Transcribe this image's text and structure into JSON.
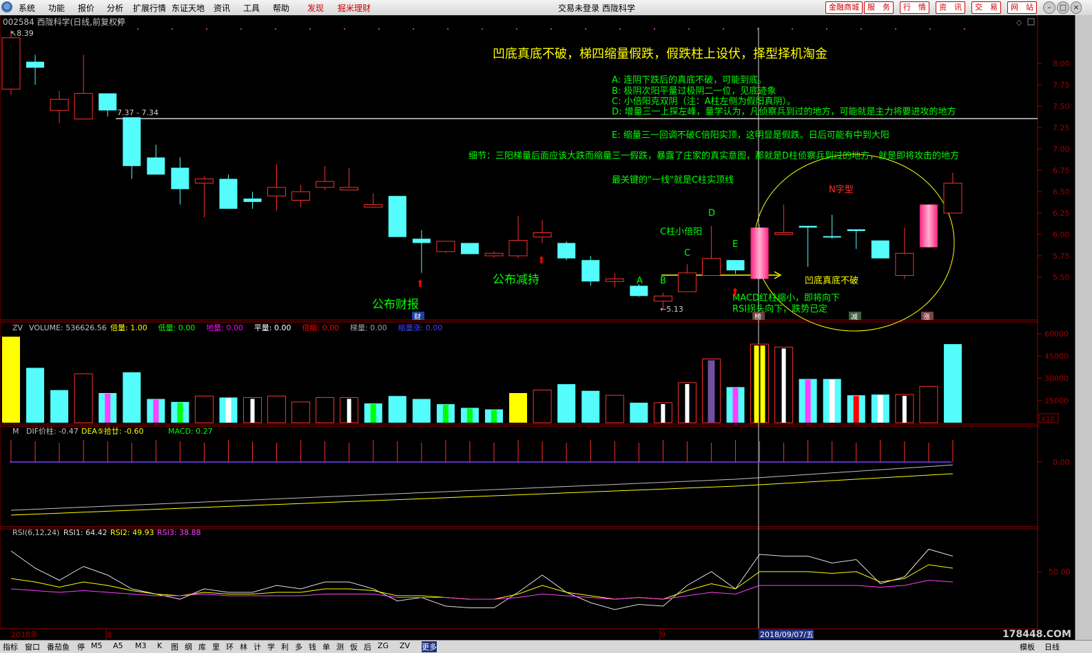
{
  "menu": {
    "items": [
      "系统",
      "功能",
      "报价",
      "分析",
      "扩展行情",
      "东证天地",
      "资讯",
      "工具",
      "帮助"
    ],
    "red_items": [
      "发现",
      "掘米理财"
    ],
    "title": "交易未登录  西陇科学",
    "right_buttons": [
      "金融商城",
      "服　务",
      "行　情",
      "资　讯",
      "交　易",
      "网　站"
    ]
  },
  "chart": {
    "header_left": "002584 西陇科学(日线,前复权)",
    "header_status": "停",
    "high_label": "8.39",
    "low_label": "5.13",
    "line_label": "7.37 - 7.34",
    "date_left": "2018年",
    "month_marks": [
      "8",
      "9"
    ],
    "cursor_date": "2018/09/07/五",
    "watermark": "178448.COM",
    "event_tags": {
      "cai": "财",
      "bang": "榜",
      "jian": "减",
      "zhang": "涨"
    },
    "price_axis": [
      "8.00",
      "7.75",
      "7.50",
      "7.25",
      "7.00",
      "6.75",
      "6.50",
      "6.25",
      "6.00",
      "5.75",
      "5.50"
    ],
    "vol_axis": [
      "60000",
      "45000",
      "30000",
      "15000"
    ],
    "vol_unit": "X10",
    "macd_axis": [
      "0.00"
    ],
    "rsi_axis": [
      "50.00"
    ]
  },
  "annotations": {
    "headline": "凹底真底不破，梯四缩量假跌，假跌柱上设伏，择型择机淘金",
    "notes": [
      "A:  连阴下跌后的真底不破，可能到底。",
      "B:  极阴次阳平量过极阴二一位，见底迹象",
      "C:  小倍阳克双阴（注：A柱左侧为假阳真阴）。",
      "D:  增量三一上探左峰，量学认为，凡侦察兵到过的地方，可能就是主力将要进攻的地方",
      "E:  缩量三一回调不破C倍阳实顶，这明显是假跌。日后可能有中到大阳"
    ],
    "detail": "细节：三阳梯量后面应该大跌而缩量三一假跌，暴露了庄家的真实意图，那就是D柱侦察兵到过的地方，就是即将攻击的地方",
    "key": "最关键的\"一线\"就是C柱实顶线",
    "n_shape": "N字型",
    "c_small": "C柱小倍阳",
    "ao_di": "凹底真底不破",
    "macd_note1": "MACD红柱缩小，即将向下",
    "macd_note2": "RSI拐头向下，跌势已定",
    "caibao": "公布财报",
    "jianchi": "公布减持",
    "letters": {
      "A": "A",
      "B": "B",
      "C": "C",
      "D": "D",
      "E": "E"
    }
  },
  "vol_header": {
    "name": "ZV",
    "volume_label": "VOLUME: 536626.56",
    "items": [
      {
        "label": "倍量: 1.00",
        "color": "#ffff00"
      },
      {
        "label": "低量: 0.00",
        "color": "#00ff00"
      },
      {
        "label": "地量: 0.00",
        "color": "#ff00ff"
      },
      {
        "label": "平量: 0.00",
        "color": "#ffffff"
      },
      {
        "label": "倍缩: 0.00",
        "color": "#ff0000"
      },
      {
        "label": "梯量: 0.00",
        "color": "#a0a0a0"
      },
      {
        "label": "缩量涨: 0.00",
        "color": "#4040ff"
      }
    ]
  },
  "macd_header": {
    "name": "M",
    "dif": "DIF价柱: -0.47",
    "dea": "DEA⑤拾廿: -0.60",
    "macd": "MACD: 0.27"
  },
  "rsi_header": {
    "name": "RSI(6,12,24)",
    "rsi1": "RSI1: 64.42",
    "rsi2": "RSI2: 49.93",
    "rsi3": "RSI3: 38.88"
  },
  "bottom": {
    "tabs": [
      "指标",
      "窗口",
      "番茄鱼",
      "停",
      "M5",
      "A5",
      "M3",
      "K",
      "图",
      "纲",
      "库",
      "里",
      "环",
      "林",
      "计",
      "学",
      "利",
      "多",
      "钱",
      "单",
      "测",
      "仮",
      "后",
      "ZG",
      "ZV",
      "更多"
    ],
    "right": [
      "模板",
      "日线"
    ]
  },
  "candles": [
    {
      "o": 7.7,
      "c": 8.3,
      "h": 8.39,
      "l": 7.63
    },
    {
      "o": 8.02,
      "c": 7.95,
      "h": 8.1,
      "l": 7.75
    },
    {
      "o": 7.45,
      "c": 7.58,
      "h": 7.68,
      "l": 7.3
    },
    {
      "o": 7.35,
      "c": 7.65,
      "h": 8.1,
      "l": 7.35
    },
    {
      "o": 7.65,
      "c": 7.45,
      "h": 7.65,
      "l": 7.38
    },
    {
      "o": 7.37,
      "c": 6.8,
      "h": 7.37,
      "l": 6.65
    },
    {
      "o": 6.9,
      "c": 6.7,
      "h": 7.05,
      "l": 6.7
    },
    {
      "o": 6.78,
      "c": 6.53,
      "h": 6.9,
      "l": 6.35
    },
    {
      "o": 6.6,
      "c": 6.65,
      "h": 6.68,
      "l": 6.2
    },
    {
      "o": 6.65,
      "c": 6.3,
      "h": 6.7,
      "l": 6.3
    },
    {
      "o": 6.42,
      "c": 6.38,
      "h": 6.5,
      "l": 6.3
    },
    {
      "o": 6.45,
      "c": 6.55,
      "h": 6.82,
      "l": 6.28
    },
    {
      "o": 6.4,
      "c": 6.5,
      "h": 6.58,
      "l": 6.32
    },
    {
      "o": 6.55,
      "c": 6.62,
      "h": 6.8,
      "l": 6.52
    },
    {
      "o": 6.52,
      "c": 6.55,
      "h": 6.78,
      "l": 6.52
    },
    {
      "o": 6.32,
      "c": 6.35,
      "h": 6.48,
      "l": 6.32
    },
    {
      "o": 6.45,
      "c": 5.97,
      "h": 6.45,
      "l": 5.97
    },
    {
      "o": 5.95,
      "c": 5.9,
      "h": 6.05,
      "l": 5.55
    },
    {
      "o": 5.8,
      "c": 5.92,
      "h": 5.92,
      "l": 5.78
    },
    {
      "o": 5.9,
      "c": 5.77,
      "h": 5.9,
      "l": 5.77
    },
    {
      "o": 5.75,
      "c": 5.78,
      "h": 5.8,
      "l": 5.73
    },
    {
      "o": 5.75,
      "c": 5.93,
      "h": 6.22,
      "l": 5.72
    },
    {
      "o": 5.97,
      "c": 6.02,
      "h": 6.17,
      "l": 5.9
    },
    {
      "o": 5.9,
      "c": 5.72,
      "h": 5.92,
      "l": 5.7
    },
    {
      "o": 5.7,
      "c": 5.45,
      "h": 5.75,
      "l": 5.4
    },
    {
      "o": 5.45,
      "c": 5.48,
      "h": 5.55,
      "l": 5.38
    },
    {
      "o": 5.4,
      "c": 5.28,
      "h": 5.42,
      "l": 5.27
    },
    {
      "o": 5.22,
      "c": 5.28,
      "h": 5.32,
      "l": 5.13
    },
    {
      "o": 5.33,
      "c": 5.55,
      "h": 5.65,
      "l": 5.33
    },
    {
      "o": 5.52,
      "c": 5.72,
      "h": 6.1,
      "l": 5.52
    },
    {
      "o": 5.7,
      "c": 5.58,
      "h": 5.7,
      "l": 5.54
    },
    {
      "o": 5.48,
      "c": 6.08,
      "h": 6.12,
      "l": 5.48,
      "hot": true
    },
    {
      "o": 6.0,
      "c": 6.02,
      "h": 6.35,
      "l": 6.0
    },
    {
      "o": 6.1,
      "c": 6.08,
      "h": 6.1,
      "l": 5.62
    },
    {
      "o": 5.98,
      "c": 5.97,
      "h": 6.23,
      "l": 5.95
    },
    {
      "o": 6.06,
      "c": 6.04,
      "h": 6.06,
      "l": 5.83
    },
    {
      "o": 5.93,
      "c": 5.72,
      "h": 5.93,
      "l": 5.72
    },
    {
      "o": 5.52,
      "c": 5.78,
      "h": 6.08,
      "l": 5.48
    },
    {
      "o": 5.85,
      "c": 6.35,
      "h": 6.35,
      "l": 5.85,
      "hot": true
    },
    {
      "o": 6.25,
      "c": 6.6,
      "h": 6.72,
      "l": 6.25
    }
  ],
  "volumes": [
    {
      "v": 58000,
      "s": "y"
    },
    {
      "v": 37000,
      "s": "c"
    },
    {
      "v": 22000,
      "s": "c"
    },
    {
      "v": 33000,
      "s": "r"
    },
    {
      "v": 20000,
      "s": "m"
    },
    {
      "v": 34000,
      "s": "c"
    },
    {
      "v": 16000,
      "s": "m"
    },
    {
      "v": 14000,
      "s": "g"
    },
    {
      "v": 18000,
      "s": "r"
    },
    {
      "v": 17000,
      "s": "w"
    },
    {
      "v": 17000,
      "s": "k"
    },
    {
      "v": 18000,
      "s": "r"
    },
    {
      "v": 14000,
      "s": "r"
    },
    {
      "v": 17000,
      "s": "r"
    },
    {
      "v": 17000,
      "s": "k"
    },
    {
      "v": 13000,
      "s": "g"
    },
    {
      "v": 18000,
      "s": "c"
    },
    {
      "v": 16000,
      "s": "c"
    },
    {
      "v": 12500,
      "s": "g"
    },
    {
      "v": 10000,
      "s": "g"
    },
    {
      "v": 9000,
      "s": "g"
    },
    {
      "v": 20000,
      "s": "y"
    },
    {
      "v": 22000,
      "s": "r"
    },
    {
      "v": 26000,
      "s": "c"
    },
    {
      "v": 21500,
      "s": "c"
    },
    {
      "v": 18500,
      "s": "r"
    },
    {
      "v": 13500,
      "s": "c"
    },
    {
      "v": 13500,
      "s": "k"
    },
    {
      "v": 27000,
      "s": "k"
    },
    {
      "v": 43000,
      "s": "p"
    },
    {
      "v": 24000,
      "s": "m"
    },
    {
      "v": 53000,
      "s": "y"
    },
    {
      "v": 51000,
      "s": "k"
    },
    {
      "v": 29500,
      "s": "m"
    },
    {
      "v": 29500,
      "s": "w"
    },
    {
      "v": 18500,
      "s": "rr"
    },
    {
      "v": 19000,
      "s": "w"
    },
    {
      "v": 19000,
      "s": "k"
    },
    {
      "v": 24500,
      "s": "r"
    },
    {
      "v": 53000,
      "s": "c"
    }
  ],
  "rsi1": [
    62,
    52,
    45,
    53,
    48,
    40,
    37,
    34,
    40,
    38,
    38,
    42,
    40,
    44,
    44,
    40,
    33,
    35,
    30,
    29,
    29,
    38,
    48,
    38,
    32,
    28,
    31,
    30,
    42,
    50,
    40,
    60,
    59,
    59,
    55,
    57,
    43,
    47,
    63,
    59
  ],
  "rsi2": [
    46,
    44,
    41,
    44,
    42,
    39,
    37,
    36,
    38,
    37,
    37,
    38,
    38,
    40,
    40,
    39,
    36,
    36,
    35,
    34,
    34,
    37,
    42,
    38,
    36,
    34,
    35,
    34,
    39,
    43,
    40,
    50,
    50,
    50,
    49,
    50,
    44,
    46,
    54,
    52
  ],
  "rsi3": [
    40,
    39,
    38,
    39,
    38,
    37,
    36,
    36,
    37,
    36,
    36,
    36,
    36,
    37,
    37,
    37,
    35,
    35,
    35,
    34,
    34,
    35,
    37,
    36,
    35,
    34,
    35,
    34,
    36,
    38,
    37,
    42,
    42,
    42,
    42,
    42,
    41,
    42,
    45,
    44
  ]
}
